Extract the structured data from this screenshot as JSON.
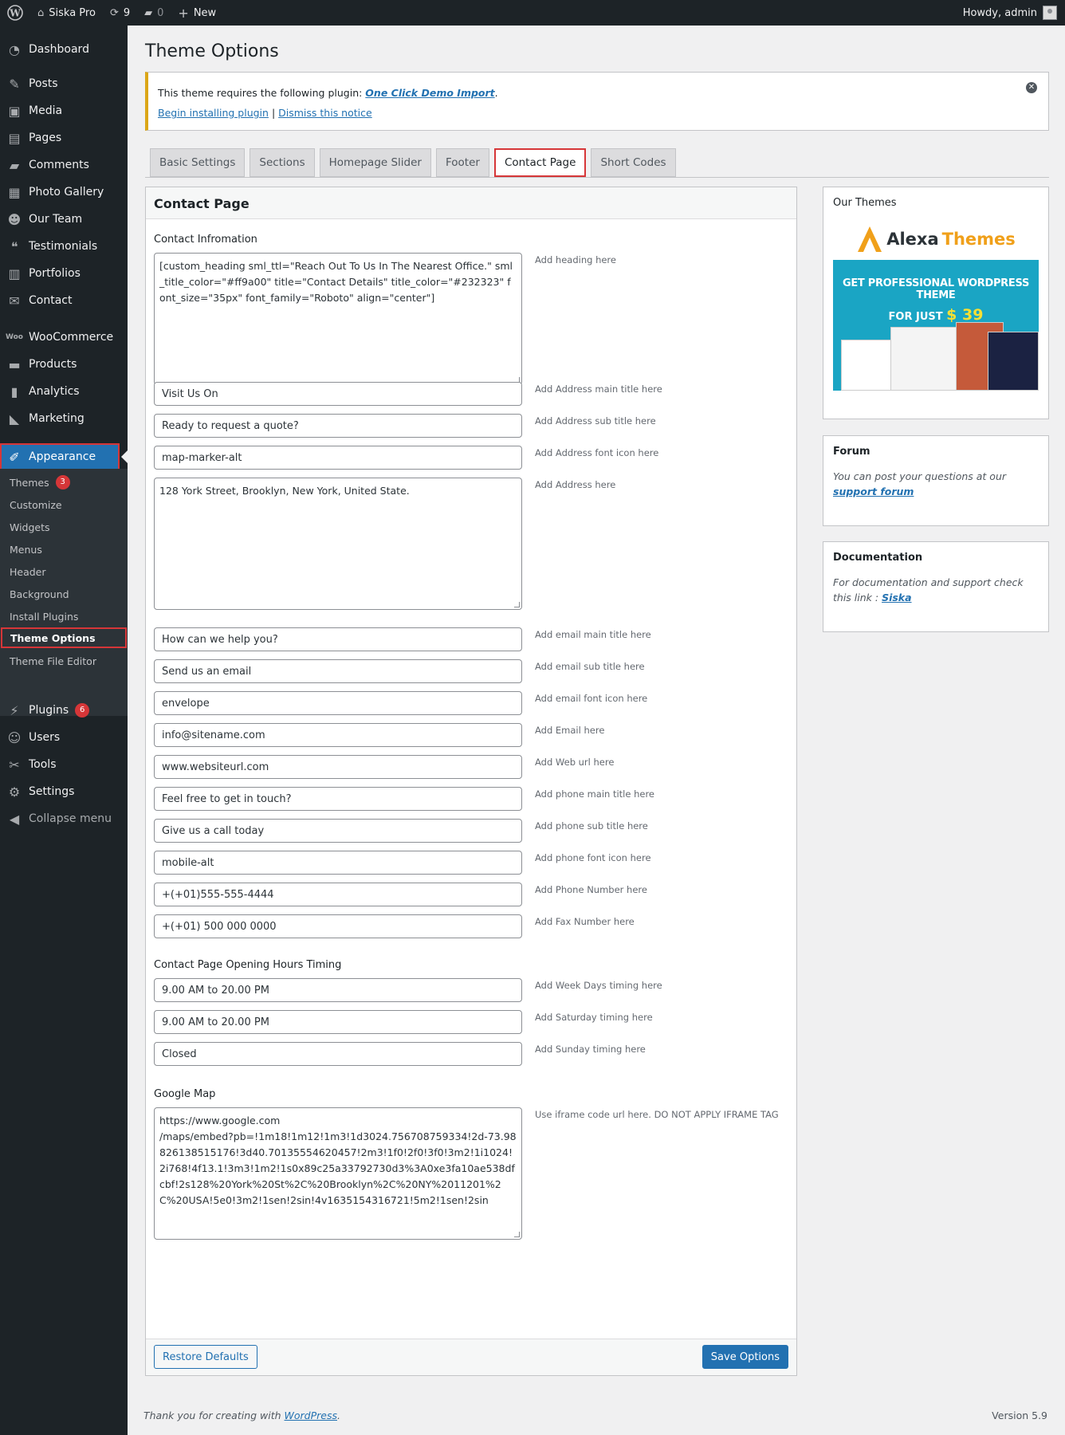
{
  "adminbar": {
    "site_name": "Siska Pro",
    "updates_count": "9",
    "comments_count": "0",
    "new_label": "New",
    "howdy": "Howdy, admin"
  },
  "sidebar": {
    "items": [
      {
        "label": "Dashboard",
        "icon": "dashboard-icon"
      },
      {
        "label": "Posts",
        "icon": "pin-icon"
      },
      {
        "label": "Media",
        "icon": "media-icon"
      },
      {
        "label": "Pages",
        "icon": "pages-icon"
      },
      {
        "label": "Comments",
        "icon": "comment-icon"
      },
      {
        "label": "Photo Gallery",
        "icon": "gallery-icon"
      },
      {
        "label": "Our Team",
        "icon": "team-icon"
      },
      {
        "label": "Testimonials",
        "icon": "quote-icon"
      },
      {
        "label": "Portfolios",
        "icon": "portfolio-icon"
      },
      {
        "label": "Contact",
        "icon": "mail-icon"
      },
      {
        "label": "WooCommerce",
        "icon": "woo-icon"
      },
      {
        "label": "Products",
        "icon": "archive-icon"
      },
      {
        "label": "Analytics",
        "icon": "chart-icon"
      },
      {
        "label": "Marketing",
        "icon": "megaphone-icon"
      },
      {
        "label": "Appearance",
        "icon": "brush-icon"
      },
      {
        "label": "Plugins",
        "icon": "plugin-icon",
        "badge": "6"
      },
      {
        "label": "Users",
        "icon": "user-icon"
      },
      {
        "label": "Tools",
        "icon": "wrench-icon"
      },
      {
        "label": "Settings",
        "icon": "settings-icon"
      },
      {
        "label": "Collapse menu",
        "icon": "collapse-icon"
      }
    ],
    "submenu": [
      {
        "label": "Themes",
        "badge": "3"
      },
      {
        "label": "Customize"
      },
      {
        "label": "Widgets"
      },
      {
        "label": "Menus"
      },
      {
        "label": "Header"
      },
      {
        "label": "Background"
      },
      {
        "label": "Install Plugins"
      },
      {
        "label": "Theme Options"
      },
      {
        "label": "Theme File Editor"
      }
    ]
  },
  "page": {
    "title": "Theme Options",
    "notice": {
      "text": "This theme requires the following plugin: ",
      "plugin_link": "One Click Demo Import",
      "period": ".",
      "begin_link": "Begin installing plugin",
      "separator": "|",
      "dismiss_link": "Dismiss this notice"
    },
    "tabs": [
      "Basic Settings",
      "Sections",
      "Homepage Slider",
      "Footer",
      "Contact Page",
      "Short Codes"
    ],
    "active_tab": "Contact Page"
  },
  "panel": {
    "title": "Contact Page",
    "contact_info_label": "Contact Infromation",
    "heading_value": "[custom_heading sml_ttl=\"Reach Out To Us In The Nearest Office.\" sml_title_color=\"#ff9a00\" title=\"Contact Details\" title_color=\"#232323\" font_size=\"35px\" font_family=\"Roboto\" align=\"center\"]",
    "heading_hint": "Add heading here",
    "fields": [
      {
        "value": "Visit Us On",
        "hint": "Add Address main title here"
      },
      {
        "value": "Ready to request a quote?",
        "hint": "Add Address sub title here"
      },
      {
        "value": "map-marker-alt",
        "hint": "Add Address font icon here"
      }
    ],
    "address_value": "128 York Street, Brooklyn, New York, United State.",
    "address_hint": "Add Address here",
    "fields2": [
      {
        "value": "How can we help you?",
        "hint": "Add email main title here"
      },
      {
        "value": "Send us an email",
        "hint": "Add email sub title here"
      },
      {
        "value": "envelope",
        "hint": "Add email font icon here"
      },
      {
        "value": "info@sitename.com",
        "hint": "Add Email here"
      },
      {
        "value": "www.websiteurl.com",
        "hint": "Add Web url here"
      },
      {
        "value": "Feel free to get in touch?",
        "hint": "Add phone main title here"
      },
      {
        "value": "Give us a call today",
        "hint": "Add phone sub title here"
      },
      {
        "value": "mobile-alt",
        "hint": "Add phone font icon here"
      },
      {
        "value": "+(+01)555-555-4444",
        "hint": "Add Phone Number here"
      },
      {
        "value": "+(+01) 500 000 0000",
        "hint": "Add Fax Number here"
      }
    ],
    "hours_label": "Contact Page Opening Hours Timing",
    "hours": [
      {
        "value": "9.00 AM to 20.00 PM",
        "hint": "Add Week Days timing here"
      },
      {
        "value": "9.00 AM to 20.00 PM",
        "hint": "Add Saturday timing here"
      },
      {
        "value": "Closed",
        "hint": "Add Sunday timing here"
      }
    ],
    "map_label": "Google Map",
    "map_value": "https://www.google.com\n/maps/embed?pb=!1m18!1m12!1m3!1d3024.756708759334!2d-73.98826138515176!3d40.70135554620457!2m3!1f0!2f0!3f0!3m2!1i1024!2i768!4f13.1!3m3!1m2!1s0x89c25a33792730d3%3A0xe3fa10ae538dfcbf!2s128%20York%20St%2C%20Brooklyn%2C%20NY%2011201%2C%20USA!5e0!3m2!1sen!2sin!4v1635154316721!5m2!1sen!2sin",
    "map_hint": "Use iframe code url here. DO NOT APPLY IFRAME TAG",
    "restore_label": "Restore Defaults",
    "save_label": "Save Options"
  },
  "widgets": {
    "themes_title": "Our Themes",
    "ad_logo_a": "Alexa",
    "ad_logo_b": "Themes",
    "ad_line1": "GET PROFESSIONAL WORDPRESS THEME",
    "ad_line2": "FOR JUST",
    "ad_price": "$ 39",
    "forum_title": "Forum",
    "forum_text": "You can post your questions at our ",
    "forum_link": "support forum",
    "docs_title": "Documentation",
    "docs_text": "For documentation and support check this link : ",
    "docs_link": "Siska"
  },
  "footer": {
    "thanks": "Thank you for creating with ",
    "wp_link": "WordPress",
    "period": ".",
    "version": "Version 5.9"
  },
  "colors": {
    "admin_bg": "#1d2327",
    "accent": "#2271b1",
    "highlight_outline": "#d63638",
    "notice_border": "#dba617"
  }
}
